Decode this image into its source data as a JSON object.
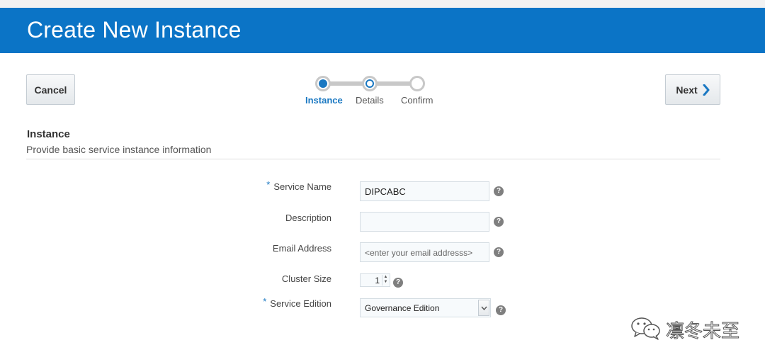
{
  "header": {
    "title": "Create New Instance"
  },
  "actions": {
    "cancel_label": "Cancel",
    "next_label": "Next"
  },
  "train": {
    "steps": [
      {
        "label": "Instance",
        "state": "current"
      },
      {
        "label": "Details",
        "state": "next"
      },
      {
        "label": "Confirm",
        "state": "pending"
      }
    ]
  },
  "section": {
    "title": "Instance",
    "subtitle": "Provide basic service instance information"
  },
  "form": {
    "required_mark": "*",
    "service_name": {
      "label": "Service Name",
      "value": "DIPCABC",
      "required": true
    },
    "description": {
      "label": "Description",
      "value": ""
    },
    "email": {
      "label": "Email Address",
      "placeholder": "<enter your email addresss>"
    },
    "cluster_size": {
      "label": "Cluster Size",
      "value": "1"
    },
    "service_edition": {
      "label": "Service Edition",
      "value": "Governance Edition",
      "required": true
    }
  },
  "help_glyph": "?",
  "watermark": {
    "text": "凛冬未至",
    "icon": "wechat-logo-icon"
  },
  "colors": {
    "header_bg": "#0b74c6",
    "accent": "#1a78c2",
    "help_icon": "#7f7f7f"
  }
}
